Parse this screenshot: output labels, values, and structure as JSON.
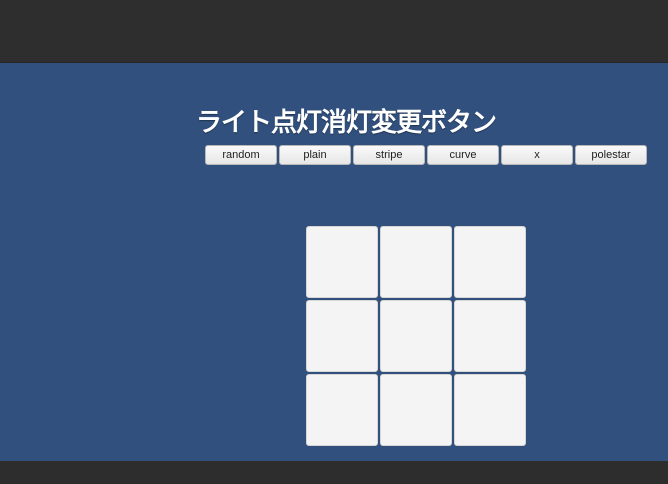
{
  "title": "ライト点灯消灯変更ボタン",
  "buttons": [
    {
      "label": "random"
    },
    {
      "label": "plain"
    },
    {
      "label": "stripe"
    },
    {
      "label": "curve"
    },
    {
      "label": "x"
    },
    {
      "label": "polestar"
    }
  ],
  "grid": {
    "rows": 3,
    "cols": 3,
    "lights": [
      [
        "off",
        "off",
        "off"
      ],
      [
        "off",
        "off",
        "off"
      ],
      [
        "off",
        "off",
        "off"
      ]
    ]
  },
  "colors": {
    "background": "#31507d",
    "light_off": "#f4f4f4",
    "editor_chrome": "#2e2e2e"
  }
}
